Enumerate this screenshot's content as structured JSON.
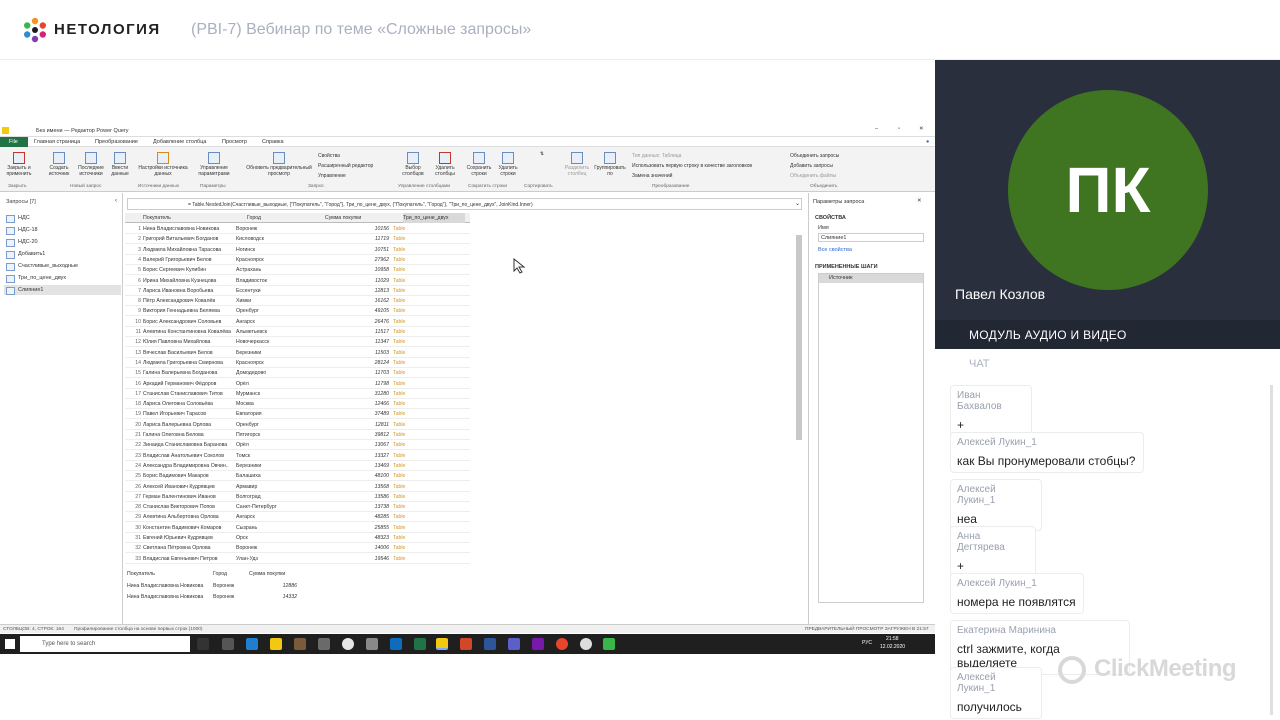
{
  "header": {
    "brand": "НЕТОЛОГИЯ",
    "title": "(PBI-7) Вебинар по теме «Сложные запросы»"
  },
  "pq": {
    "window_title": "Без имени — Редактор Power Query",
    "tabs": [
      "File",
      "Главная страница",
      "Преобразование",
      "Добавление столбца",
      "Просмотр",
      "Справка"
    ],
    "ribbon_buttons": [
      {
        "label": "Закрыть и применить"
      },
      {
        "label": "Создать источник"
      },
      {
        "label": "Последние источники"
      },
      {
        "label": "Ввести данные"
      },
      {
        "label": "Настройки источника данных"
      },
      {
        "label": "Управление параметрами"
      },
      {
        "label": "Обновить предварительный просмотр"
      },
      {
        "label": "Выбор столбцов"
      },
      {
        "label": "Удалить столбцы"
      },
      {
        "label": "Сохранить строки"
      },
      {
        "label": "Удалить строки"
      },
      {
        "label": "Разделить столбец"
      },
      {
        "label": "Группировать по"
      }
    ],
    "ribbon_small": [
      "Свойства",
      "Расширенный редактор",
      "Управление",
      "Тип данных: Таблица",
      "Использовать первую строку в качестве заголовков",
      "Замена значений",
      "Объединить запросы",
      "Добавить запросы",
      "Объединить файлы"
    ],
    "ribbon_groups": [
      "Закрыть",
      "Новый запрос",
      "Источники данных",
      "Параметры",
      "Запрос",
      "Управление столбцами",
      "Сократить строки",
      "Сортировать",
      "Преобразование",
      "Объединить"
    ],
    "queries_header": "Запросы [7]",
    "queries": [
      "НДС",
      "НДС-18",
      "НДС-20",
      "Добавить1",
      "Счастливые_выходные",
      "Три_по_цене_двух",
      "Слияние1"
    ],
    "formula": "= Table.NestedJoin(Счастливые_выходные, {\"Покупатель\", \"Город\"}, Три_по_цене_двух, {\"Покупатель\", \"Город\"}, \"Три_по_цене_двух\", JoinKind.Inner)",
    "columns": [
      "Покупатель",
      "Город",
      "Сумма покупки",
      "Три_по_цене_двух"
    ],
    "rows": [
      [
        "1",
        "Нина Владиславовна Новикова",
        "Воронеж",
        "10156",
        "Table"
      ],
      [
        "2",
        "Григорий Витальевич Богданов",
        "Кисловодск",
        "11719",
        "Table"
      ],
      [
        "3",
        "Людмила Михайловна Тарасова",
        "Ногинск",
        "10751",
        "Table"
      ],
      [
        "4",
        "Валерий Григорьевич Белов",
        "Красноярск",
        "27962",
        "Table"
      ],
      [
        "5",
        "Борис Сергеевич Кулибин",
        "Астрахань",
        "10958",
        "Table"
      ],
      [
        "6",
        "Ирина Михайловна Кузнецова",
        "Владивосток",
        "11029",
        "Table"
      ],
      [
        "7",
        "Лариса Ивановна Воробьева",
        "Ессентуки",
        "12813",
        "Table"
      ],
      [
        "8",
        "Пётр Александрович Ковалёв",
        "Химки",
        "16162",
        "Table"
      ],
      [
        "9",
        "Виктория Геннадьевна Беляева",
        "Оренбург",
        "49105",
        "Table"
      ],
      [
        "10",
        "Борис Александрович Соловьев",
        "Ангарск",
        "26476",
        "Table"
      ],
      [
        "11",
        "Алевтина Константиновна Ковалёва",
        "Альметьевск",
        "11517",
        "Table"
      ],
      [
        "12",
        "Юлия Павловна Михайлова",
        "Новочеркасск",
        "11347",
        "Table"
      ],
      [
        "13",
        "Вячеслав Васильевич Белов",
        "Березники",
        "11503",
        "Table"
      ],
      [
        "14",
        "Людмила Григорьевна Смирнова",
        "Красноярск",
        "28124",
        "Table"
      ],
      [
        "15",
        "Галина Валерьевна Богданова",
        "Домодедово",
        "11703",
        "Table"
      ],
      [
        "16",
        "Аркадий Германович Фёдоров",
        "Орёл",
        "11798",
        "Table"
      ],
      [
        "17",
        "Станислав Станиславович Титов",
        "Мурманск",
        "31280",
        "Table"
      ],
      [
        "18",
        "Лариса Олеговна Соловьёва",
        "Москва",
        "12466",
        "Table"
      ],
      [
        "19",
        "Павел Игорьевич Тарасов",
        "Евпатория",
        "37489",
        "Table"
      ],
      [
        "20",
        "Лариса Валерьевна Орлова",
        "Оренбург",
        "12811",
        "Table"
      ],
      [
        "21",
        "Галина Олеговна Белова",
        "Пятигорск",
        "39812",
        "Table"
      ],
      [
        "22",
        "Зинаида Станиславовна Баранова",
        "Орёл",
        "13067",
        "Table"
      ],
      [
        "23",
        "Владислав Анатольевич Соколов",
        "Томск",
        "13327",
        "Table"
      ],
      [
        "24",
        "Александра Владимировна Овчин..",
        "Березники",
        "13469",
        "Table"
      ],
      [
        "25",
        "Борис Вадимович Макаров",
        "Балашиха",
        "48100",
        "Table"
      ],
      [
        "26",
        "Алексей Иванович Кудрявцев",
        "Армавир",
        "13568",
        "Table"
      ],
      [
        "27",
        "Герман Валентинович Иванов",
        "Волгоград",
        "13586",
        "Table"
      ],
      [
        "28",
        "Станислав Викторович Попов",
        "Санкт-Петербург",
        "13738",
        "Table"
      ],
      [
        "29",
        "Алевтина Альбертовна Орлова",
        "Ангарск",
        "48285",
        "Table"
      ],
      [
        "30",
        "Константин Вадимович Комаров",
        "Сызрань",
        "25855",
        "Table"
      ],
      [
        "31",
        "Евгений Юрьевич Кудрявцев",
        "Орск",
        "48323",
        "Table"
      ],
      [
        "32",
        "Светлана Пётровна Орлова",
        "Воронеж",
        "14006",
        "Table"
      ],
      [
        "33",
        "Владислав Евгеньевич Петров",
        "Улан-Удэ",
        "19546",
        "Table"
      ]
    ],
    "preview_columns": [
      "Покупатель",
      "Город",
      "Сумма покупки"
    ],
    "preview_rows": [
      [
        "Нина Владиславовна Новикова",
        "Воронеж",
        "12886"
      ],
      [
        "Нина Владиславовна Новикова",
        "Воронеж",
        "14332"
      ]
    ],
    "settings": {
      "title": "Параметры запроса",
      "props_header": "СВОЙСТВА",
      "name_label": "Имя",
      "name_value": "Слияние1",
      "all_props": "Все свойства",
      "steps_header": "ПРИМЕНЕННЫЕ ШАГИ",
      "step": "Источник"
    },
    "status_left": "СТОЛБЦОВ: 4, СТРОК: 164",
    "status_mid": "Профилирование столбца на основе первых строк (1000)",
    "status_right": "ПРЕДВАРИТЕЛЬНЫЙ ПРОСМОТР ЗАГРУЖЕН В 21:57",
    "taskbar_search": "Type here to search",
    "clock_time": "21:58",
    "clock_date": "12.02.2020",
    "lang": "РУС"
  },
  "video": {
    "initials": "ПК",
    "name": "Павел Козлов",
    "avatar_color": "#3f7421"
  },
  "module_label": "МОДУЛЬ АУДИО И ВИДЕО",
  "chat": {
    "header": "ЧАТ",
    "messages": [
      {
        "who": "Иван Бахвалов",
        "text": "+"
      },
      {
        "who": "Алексей Лукин_1",
        "text": "как Вы пронумеровали стобцы?"
      },
      {
        "who": "Алексей Лукин_1",
        "text": "неа"
      },
      {
        "who": "Анна Дегтярева",
        "text": "+"
      },
      {
        "who": "Алексей Лукин_1",
        "text": "номера не появлятся"
      },
      {
        "who": "Екатерина Маринина",
        "text": "ctrl зажмите, когда выделяете"
      },
      {
        "who": "Алексей Лукин_1",
        "text": "получилось"
      }
    ]
  },
  "watermark": "ClickMeeting"
}
